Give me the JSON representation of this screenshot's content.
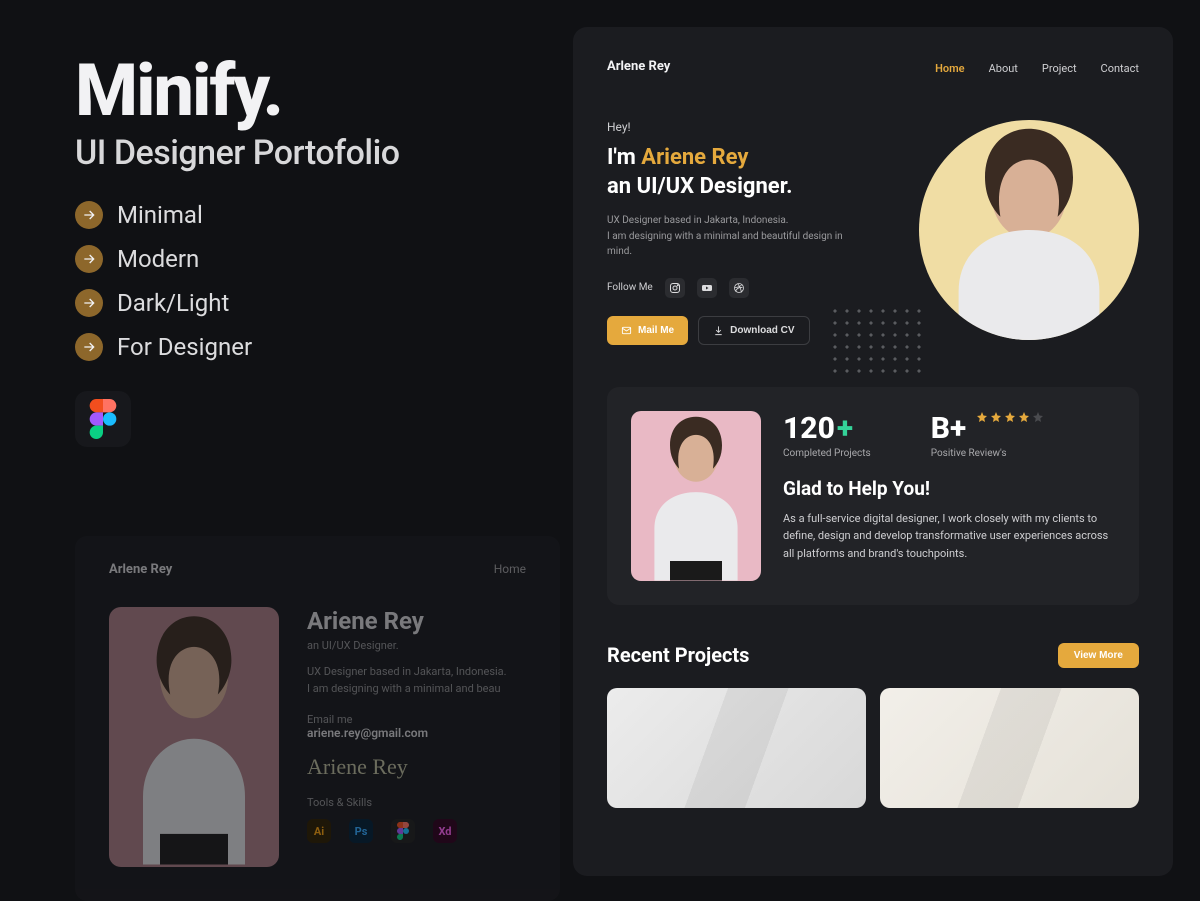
{
  "left": {
    "brand": "Minify.",
    "subtitle": "UI Designer Portofolio",
    "features": [
      "Minimal",
      "Modern",
      "Dark/Light",
      "For Designer"
    ]
  },
  "figma": {
    "name": "figma-icon"
  },
  "faded": {
    "logo": "Arlene Rey",
    "nav": "Home",
    "name": "Ariene  Rey",
    "role": "an UI/UX Designer.",
    "bio1": "UX Designer based in Jakarta, Indonesia.",
    "bio2": "I am designing with a minimal and beau",
    "email_lbl": "Email me",
    "email": "ariene.rey@gmail.com",
    "signature": "Ariene Rey",
    "tools_lbl": "Tools & Skills",
    "tools": [
      "Ai",
      "Ps",
      "Fg",
      "Xd"
    ]
  },
  "preview": {
    "logo": "Arlene Rey",
    "nav": [
      {
        "label": "Home",
        "active": true
      },
      {
        "label": "About",
        "active": false
      },
      {
        "label": "Project",
        "active": false
      },
      {
        "label": "Contact",
        "active": false
      }
    ],
    "hero": {
      "greet": "Hey!",
      "line1_pre": "I'm ",
      "line1_accent": "Ariene  Rey",
      "line2": "an UI/UX Designer.",
      "bio1": "UX Designer based in Jakarta, Indonesia.",
      "bio2": "I am designing with a minimal and beautiful design in mind.",
      "follow_lbl": "Follow Me",
      "mail_btn": "Mail Me",
      "download_btn": "Download CV"
    },
    "stats": {
      "count": "120",
      "count_lbl": "Completed Projects",
      "review": "B+",
      "review_lbl": "Positive Review's",
      "stars_filled": 4,
      "stars_total": 5,
      "title": "Glad to Help You!",
      "desc": "As a full-service digital designer, I work closely with my clients to define, design and develop transformative user experiences across all platforms and brand's touchpoints."
    },
    "recent": {
      "title": "Recent Projects",
      "view_more": "View More"
    }
  },
  "colors": {
    "accent": "#e5a93d",
    "green": "#34d399"
  }
}
